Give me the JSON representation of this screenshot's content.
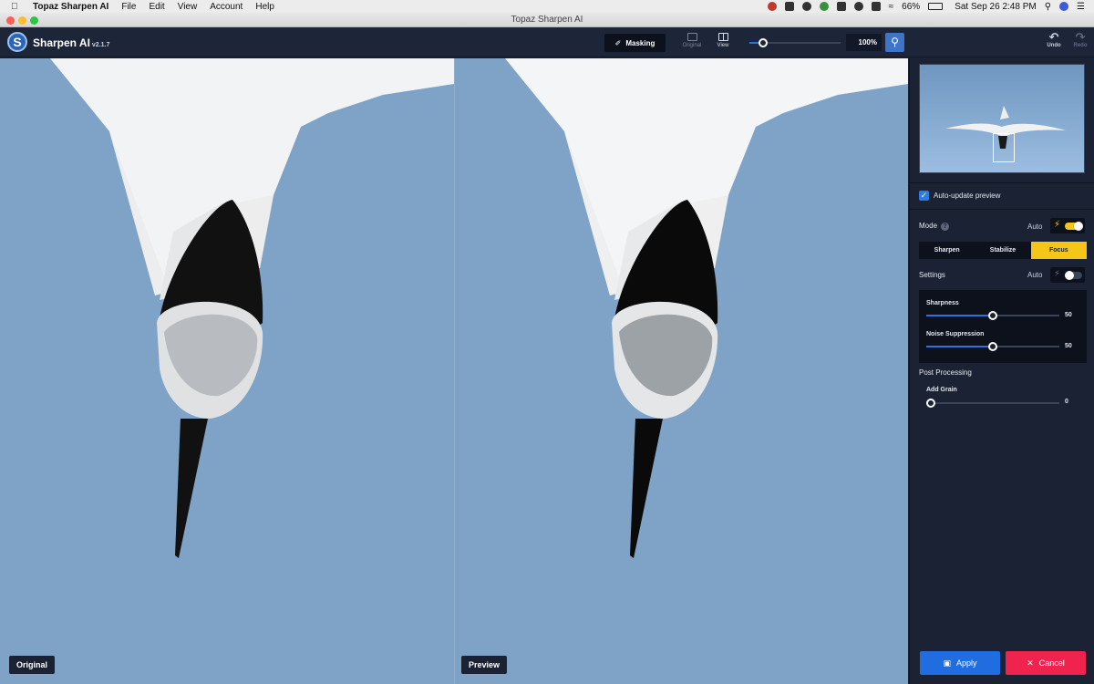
{
  "menubar": {
    "app_name": "Topaz Sharpen AI",
    "items": [
      "File",
      "Edit",
      "View",
      "Account",
      "Help"
    ],
    "battery": "66%",
    "datetime": "Sat Sep 26  2:48 PM"
  },
  "window": {
    "title": "Topaz Sharpen AI"
  },
  "toolbar": {
    "app_name": "Sharpen AI",
    "version": "v2.1.7",
    "masking_label": "Masking",
    "original_label": "Original",
    "view_label": "View",
    "zoom_value": "100%",
    "zoom_slider_fraction": 0.15,
    "undo_label": "Undo",
    "redo_label": "Redo"
  },
  "canvas": {
    "original_label": "Original",
    "preview_label": "Preview"
  },
  "panel": {
    "auto_update_label": "Auto-update preview",
    "auto_update_checked": true,
    "mode_label": "Mode",
    "mode_auto_label": "Auto",
    "mode_auto_on": true,
    "modes": [
      "Sharpen",
      "Stabilize",
      "Focus"
    ],
    "active_mode": "Focus",
    "settings_label": "Settings",
    "settings_auto_label": "Auto",
    "settings_auto_on": false,
    "sharpness_label": "Sharpness",
    "sharpness_value": "50",
    "noise_label": "Noise Suppression",
    "noise_value": "50",
    "post_processing_label": "Post Processing",
    "grain_label": "Add Grain",
    "grain_value": "0",
    "apply_label": "Apply",
    "cancel_label": "Cancel"
  },
  "colors": {
    "accent_yellow": "#f5c518",
    "accent_blue": "#1f6de0",
    "cancel_red": "#f0224e",
    "panel_bg": "#1b2233"
  }
}
